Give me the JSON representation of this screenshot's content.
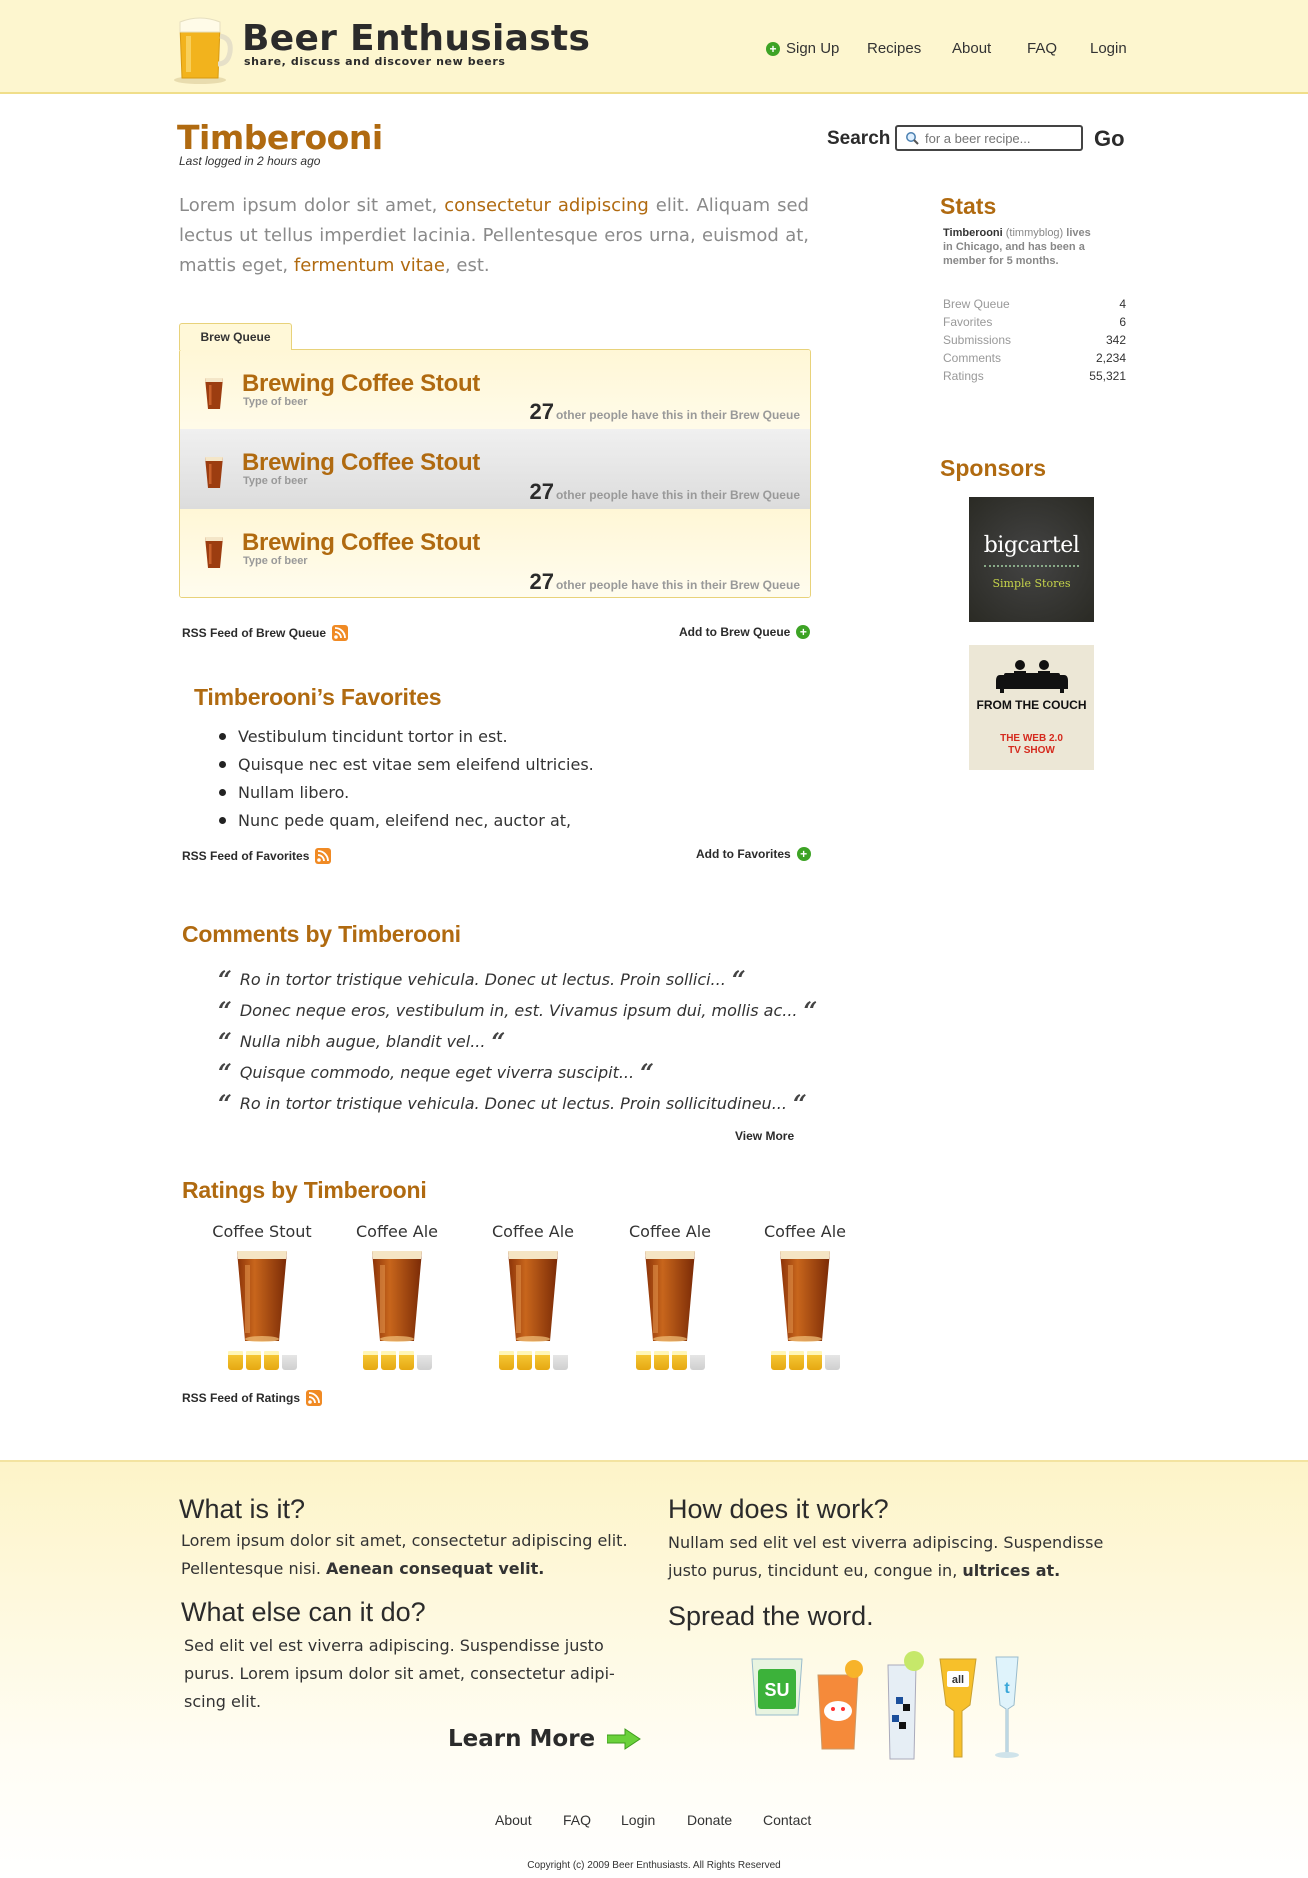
{
  "header": {
    "brand": "Beer Enthusiasts",
    "tagline": "share, discuss and discover new beers",
    "nav": [
      "Sign Up",
      "Recipes",
      "About",
      "FAQ",
      "Login"
    ]
  },
  "search": {
    "label": "Search",
    "placeholder": "for a beer recipe...",
    "go": "Go"
  },
  "profile": {
    "name": "Timberooni",
    "last_logged": "Last logged in 2 hours ago",
    "intro": {
      "p1": "Lorem ipsum dolor sit amet, ",
      "link1": "consectetur adipiscing",
      "p2": " elit. Aliquam sed lectus ut tellus imperdiet lacinia. Pellentesque eros urna, euismod at, mattis eget, ",
      "link2": "fermentum vitae",
      "p3": ", est."
    }
  },
  "brew_queue": {
    "tab": "Brew Queue",
    "items": [
      {
        "name": "Brewing Coffee Stout",
        "type": "Type of beer",
        "count": "27",
        "count_text": "other people have this in their Brew Queue"
      },
      {
        "name": "Brewing Coffee Stout",
        "type": "Type of beer",
        "count": "27",
        "count_text": "other people have this in their Brew Queue"
      },
      {
        "name": "Brewing Coffee Stout",
        "type": "Type of beer",
        "count": "27",
        "count_text": "other people have this in their Brew Queue"
      }
    ],
    "rss": "RSS Feed of Brew Queue",
    "add": "Add to Brew Queue"
  },
  "favorites": {
    "title": "Timberooni’s Favorites",
    "items": [
      "Vestibulum tincidunt tortor in est.",
      "Quisque nec est vitae sem eleifend ultricies.",
      "Nullam libero.",
      "Nunc pede quam, eleifend nec, auctor at,"
    ],
    "rss": "RSS Feed of Favorites",
    "add": "Add to Favorites"
  },
  "comments": {
    "title": "Comments by Timberooni",
    "items": [
      "Ro in tortor tristique vehicula. Donec ut lectus. Proin sollici...",
      "Donec neque eros, vestibulum in, est. Vivamus ipsum dui, mollis ac...",
      "Nulla nibh augue, blandit vel...",
      "Quisque commodo, neque eget viverra suscipit...",
      "Ro in tortor tristique vehicula. Donec ut lectus. Proin sollicitudineu..."
    ],
    "view_more": "View More"
  },
  "ratings": {
    "title": "Ratings by Timberooni",
    "items": [
      {
        "name": "Coffee Stout",
        "rating": 3,
        "max": 4
      },
      {
        "name": "Coffee Ale",
        "rating": 3,
        "max": 4
      },
      {
        "name": "Coffee Ale",
        "rating": 3,
        "max": 4
      },
      {
        "name": "Coffee Ale",
        "rating": 3,
        "max": 4
      },
      {
        "name": "Coffee Ale",
        "rating": 3,
        "max": 4
      }
    ],
    "rss": "RSS Feed of Ratings"
  },
  "stats": {
    "title": "Stats",
    "user": "Timberooni",
    "handle": "(timmyblog)",
    "desc": "lives in Chicago, and has been a member for 5 months.",
    "rows": [
      {
        "label": "Brew Queue",
        "value": "4"
      },
      {
        "label": "Favorites",
        "value": "6"
      },
      {
        "label": "Submissions",
        "value": "342"
      },
      {
        "label": "Comments",
        "value": "2,234"
      },
      {
        "label": "Ratings",
        "value": "55,321"
      }
    ]
  },
  "sponsors": {
    "title": "Sponsors",
    "ad1": {
      "name": "bigcartel",
      "tagline": "Simple Stores"
    },
    "ad2": {
      "name": "FROM THE COUCH",
      "line1": "THE WEB 2.0",
      "line2": "TV SHOW"
    }
  },
  "footer": {
    "what_title": "What is it?",
    "what_text": "Lorem ipsum dolor sit amet, consectetur adipiscing elit. Pellentesque nisi. ",
    "what_bold": "Aenean consequat velit.",
    "how_title": "How does it work?",
    "how_text": "Nullam sed elit vel est viverra adipiscing. Suspendisse justo purus, tincidunt eu, congue in, ",
    "how_bold": "ultrices at.",
    "else_title": "What else can it do?",
    "else_text": "Sed elit vel est viverra adipiscing. Suspendisse justo purus. Lorem ipsum dolor sit amet, consectetur adipi-scing elit.",
    "learn_more": "Learn More",
    "spread_title": "Spread the word.",
    "nav": [
      "About",
      "FAQ",
      "Login",
      "Donate",
      "Contact"
    ],
    "copyright": "Copyright (c) 2009 Beer Enthusiasts. All Rights Reserved"
  },
  "colors": {
    "accent": "#b06a10",
    "header_bg": "#fdf6cf",
    "green": "#3da325",
    "rss": "#f08a24"
  }
}
